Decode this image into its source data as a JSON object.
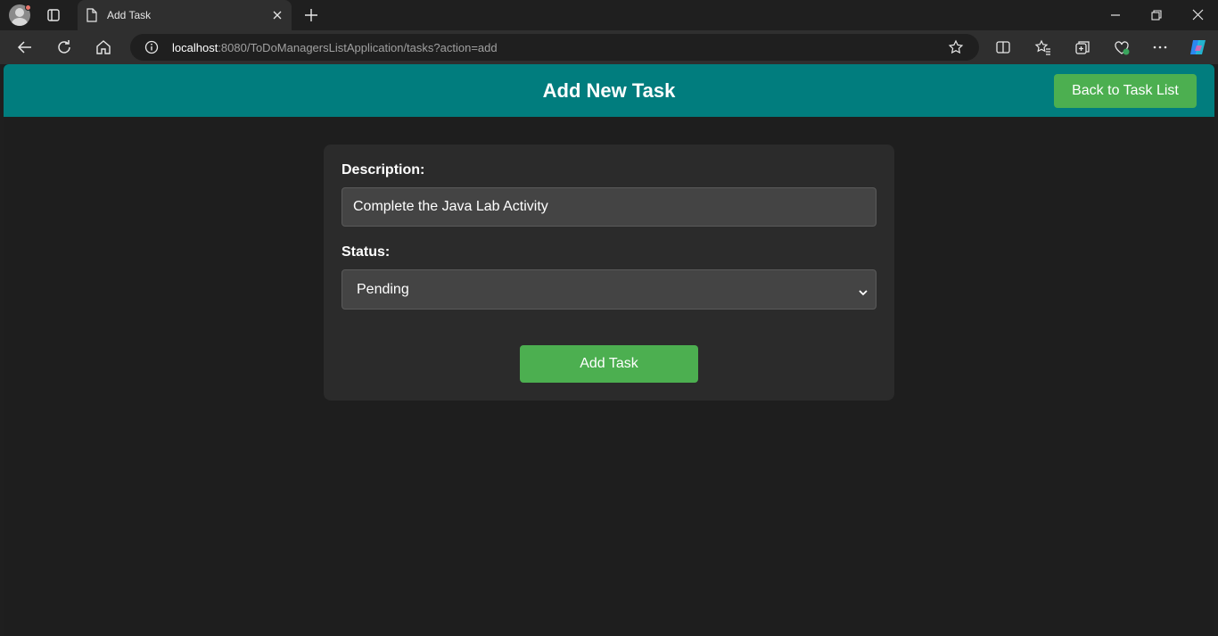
{
  "browser": {
    "tab_title": "Add Task",
    "url_host": "localhost",
    "url_rest": ":8080/ToDoManagersListApplication/tasks?action=add"
  },
  "header": {
    "title": "Add New Task",
    "back_button_label": "Back to Task List"
  },
  "form": {
    "description_label": "Description:",
    "description_value": "Complete the Java Lab Activity",
    "status_label": "Status:",
    "status_selected": "Pending",
    "submit_label": "Add Task"
  },
  "colors": {
    "header_bg": "#017d7e",
    "button_green": "#4caf50",
    "page_bg": "#1e1e1e",
    "card_bg": "#2b2b2b"
  }
}
